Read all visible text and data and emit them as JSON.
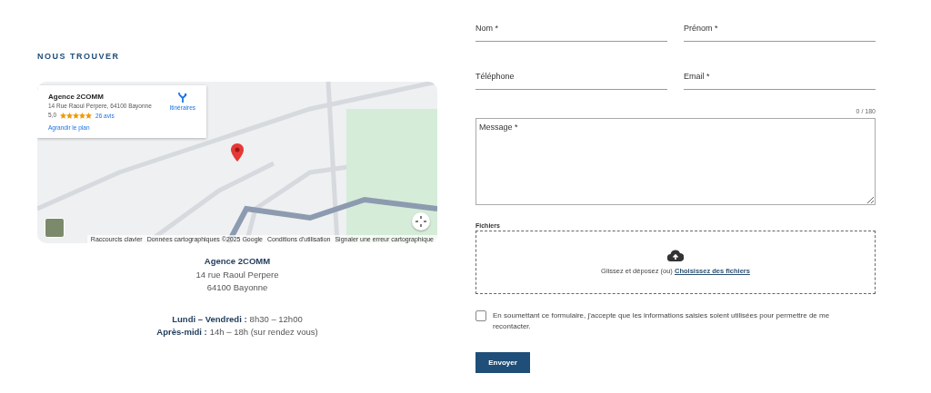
{
  "location": {
    "heading": "NOUS TROUVER",
    "map": {
      "card": {
        "name": "Agence 2COMM",
        "address": "14 Rue Raoul Perpere, 64100 Bayonne",
        "rating": "5,0",
        "stars": 5,
        "reviews": "26 avis",
        "enlarge": "Agrandir le plan",
        "directions": "Itinéraires"
      },
      "attribution": [
        "Raccourcis clavier",
        "Données cartographiques ©2025 Google",
        "Conditions d'utilisation",
        "Signaler une erreur cartographique"
      ]
    },
    "address": [
      "Agence 2COMM",
      "14 rue Raoul Perpere",
      "64100 Bayonne"
    ],
    "hours": [
      {
        "days": "Lundi – Vendredi :",
        "time": "8h30 – 12h00"
      },
      {
        "days": "Après-midi :",
        "time": "14h – 18h (sur rendez vous)"
      }
    ]
  },
  "form": {
    "fields": [
      {
        "label": "Nom *"
      },
      {
        "label": "Prénom *"
      },
      {
        "label": "Téléphone"
      },
      {
        "label": "Email *"
      }
    ],
    "counter": "0 / 180",
    "message": {
      "placeholder": "Message *"
    },
    "files": {
      "label": "Fichiers",
      "text": "Glissez et déposez (ou)",
      "link": "Choisissez des fichiers"
    },
    "consent": {
      "checked": false,
      "text": "En soumettant ce formulaire, j'accepte que les informations saisies soient utilisées pour permettre de me recontacter."
    },
    "submit": "Envoyer"
  }
}
